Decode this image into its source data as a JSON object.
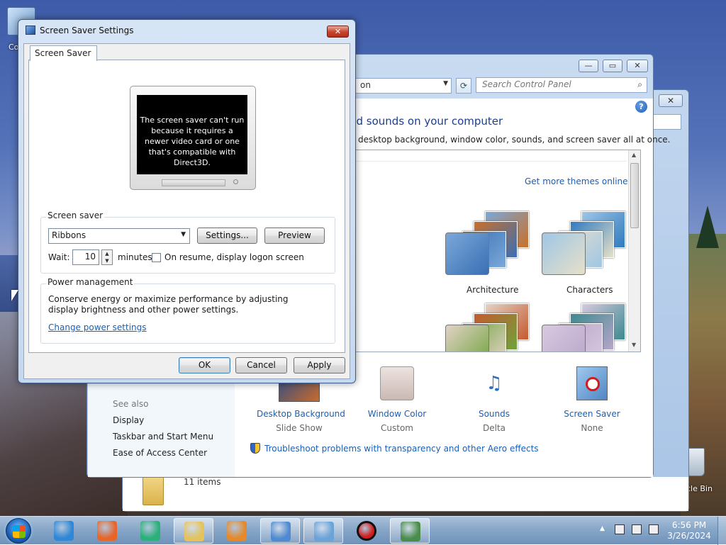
{
  "desktop": {
    "icon_left_label": "Co",
    "icon_right_label": "cle Bin"
  },
  "explorer": {
    "close_label": "✕",
    "status": "11 items"
  },
  "control_panel": {
    "minimize_label": "—",
    "maximize_label": "▭",
    "close_label": "✕",
    "address_text": "on",
    "search_placeholder": "Search Control Panel",
    "help_label": "?",
    "headline": "nd sounds on your computer",
    "subline": "desktop background, window color, sounds, and screen saver all at once.",
    "get_more": "Get more themes online",
    "themes": [
      {
        "label": "Architecture",
        "colors": [
          "#3a6fb5",
          "#c9702a",
          "#7aa8d8"
        ]
      },
      {
        "label": "Characters",
        "colors": [
          "#e7e0c8",
          "#2f7bbf",
          "#9fc6e6"
        ]
      },
      {
        "label": "",
        "colors": [
          "#6ea33b",
          "#c65a2e",
          "#e2d2c6"
        ]
      },
      {
        "label": "",
        "colors": [
          "#b9a5c9",
          "#3b8a8f",
          "#d8c9e0"
        ]
      }
    ],
    "bottom_items": [
      {
        "title": "Desktop Background",
        "sub": "Slide Show"
      },
      {
        "title": "Window Color",
        "sub": "Custom"
      },
      {
        "title": "Sounds",
        "sub": "Delta"
      },
      {
        "title": "Screen Saver",
        "sub": "None"
      }
    ],
    "see_also": "See also",
    "nav_links": [
      "Display",
      "Taskbar and Start Menu",
      "Ease of Access Center"
    ],
    "troubleshoot": "Troubleshoot problems with transparency and other Aero effects"
  },
  "dialog": {
    "title": "Screen Saver Settings",
    "close_label": "✕",
    "tab_label": "Screen Saver",
    "preview_message": "The screen saver can't run because it requires a newer video card or one that's compatible with Direct3D.",
    "screensaver_group": "Screen saver",
    "selected_screensaver": "Ribbons",
    "settings_button": "Settings...",
    "preview_button": "Preview",
    "wait_label": "Wait:",
    "wait_value": "10",
    "minutes_label": "minutes",
    "resume_checkbox_label": "On resume, display logon screen",
    "resume_checked": false,
    "power_group": "Power management",
    "power_text": "Conserve energy or maximize performance by adjusting display brightness and other power settings.",
    "power_link": "Change power settings",
    "ok_button": "OK",
    "cancel_button": "Cancel",
    "apply_button": "Apply"
  },
  "taskbar": {
    "apps": [
      {
        "name": "internet-explorer-icon",
        "color": "#2f88d6",
        "active": false
      },
      {
        "name": "firefox-icon",
        "color": "#e8652a",
        "active": false
      },
      {
        "name": "edge-icon",
        "color": "#2bb07a",
        "active": false
      },
      {
        "name": "file-explorer-icon",
        "color": "#e6c25a",
        "active": true
      },
      {
        "name": "media-player-icon",
        "color": "#e58a2a",
        "active": false
      },
      {
        "name": "control-panel-icon",
        "color": "#4f8ad0",
        "active": true
      },
      {
        "name": "personalization-icon",
        "color": "#6aa3d8",
        "active": true
      },
      {
        "name": "record-icon",
        "color": "#d21c1c",
        "active": false
      },
      {
        "name": "screensaver-settings-icon",
        "color": "#4a8c4a",
        "active": true
      }
    ],
    "time": "6:56 PM",
    "date": "3/26/2024"
  }
}
